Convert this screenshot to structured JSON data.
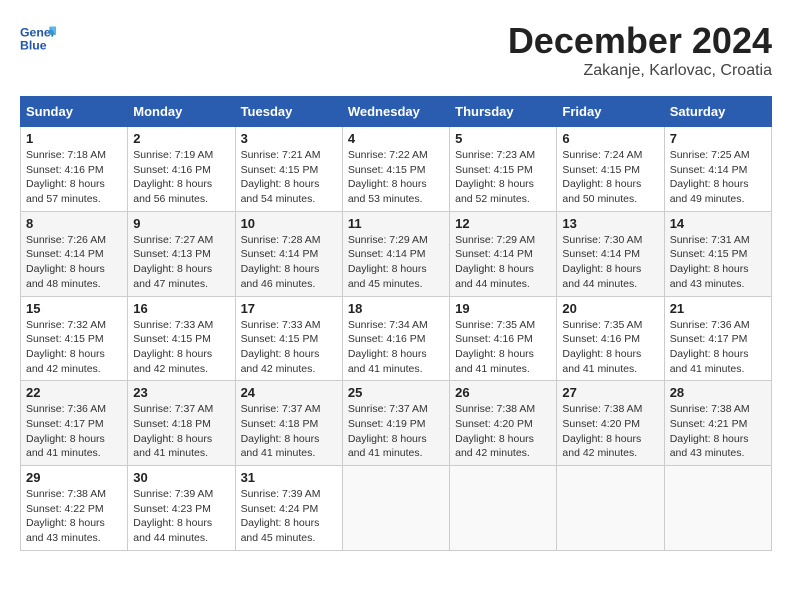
{
  "header": {
    "logo_line1": "General",
    "logo_line2": "Blue",
    "month_title": "December 2024",
    "subtitle": "Zakanje, Karlovac, Croatia"
  },
  "calendar": {
    "days_of_week": [
      "Sunday",
      "Monday",
      "Tuesday",
      "Wednesday",
      "Thursday",
      "Friday",
      "Saturday"
    ],
    "weeks": [
      [
        null,
        null,
        null,
        null,
        null,
        null,
        null
      ]
    ],
    "cells": [
      {
        "day": null,
        "lines": []
      },
      {
        "day": null,
        "lines": []
      },
      {
        "day": null,
        "lines": []
      },
      {
        "day": null,
        "lines": []
      },
      {
        "day": null,
        "lines": []
      },
      {
        "day": null,
        "lines": []
      },
      {
        "day": null,
        "lines": []
      }
    ]
  },
  "days": [
    {
      "date": "1",
      "sunrise": "Sunrise: 7:18 AM",
      "sunset": "Sunset: 4:16 PM",
      "daylight": "Daylight: 8 hours and 57 minutes."
    },
    {
      "date": "2",
      "sunrise": "Sunrise: 7:19 AM",
      "sunset": "Sunset: 4:16 PM",
      "daylight": "Daylight: 8 hours and 56 minutes."
    },
    {
      "date": "3",
      "sunrise": "Sunrise: 7:21 AM",
      "sunset": "Sunset: 4:15 PM",
      "daylight": "Daylight: 8 hours and 54 minutes."
    },
    {
      "date": "4",
      "sunrise": "Sunrise: 7:22 AM",
      "sunset": "Sunset: 4:15 PM",
      "daylight": "Daylight: 8 hours and 53 minutes."
    },
    {
      "date": "5",
      "sunrise": "Sunrise: 7:23 AM",
      "sunset": "Sunset: 4:15 PM",
      "daylight": "Daylight: 8 hours and 52 minutes."
    },
    {
      "date": "6",
      "sunrise": "Sunrise: 7:24 AM",
      "sunset": "Sunset: 4:15 PM",
      "daylight": "Daylight: 8 hours and 50 minutes."
    },
    {
      "date": "7",
      "sunrise": "Sunrise: 7:25 AM",
      "sunset": "Sunset: 4:14 PM",
      "daylight": "Daylight: 8 hours and 49 minutes."
    },
    {
      "date": "8",
      "sunrise": "Sunrise: 7:26 AM",
      "sunset": "Sunset: 4:14 PM",
      "daylight": "Daylight: 8 hours and 48 minutes."
    },
    {
      "date": "9",
      "sunrise": "Sunrise: 7:27 AM",
      "sunset": "Sunset: 4:13 PM",
      "daylight": "Daylight: 8 hours and 47 minutes."
    },
    {
      "date": "10",
      "sunrise": "Sunrise: 7:28 AM",
      "sunset": "Sunset: 4:14 PM",
      "daylight": "Daylight: 8 hours and 46 minutes."
    },
    {
      "date": "11",
      "sunrise": "Sunrise: 7:29 AM",
      "sunset": "Sunset: 4:14 PM",
      "daylight": "Daylight: 8 hours and 45 minutes."
    },
    {
      "date": "12",
      "sunrise": "Sunrise: 7:29 AM",
      "sunset": "Sunset: 4:14 PM",
      "daylight": "Daylight: 8 hours and 44 minutes."
    },
    {
      "date": "13",
      "sunrise": "Sunrise: 7:30 AM",
      "sunset": "Sunset: 4:14 PM",
      "daylight": "Daylight: 8 hours and 44 minutes."
    },
    {
      "date": "14",
      "sunrise": "Sunrise: 7:31 AM",
      "sunset": "Sunset: 4:15 PM",
      "daylight": "Daylight: 8 hours and 43 minutes."
    },
    {
      "date": "15",
      "sunrise": "Sunrise: 7:32 AM",
      "sunset": "Sunset: 4:15 PM",
      "daylight": "Daylight: 8 hours and 42 minutes."
    },
    {
      "date": "16",
      "sunrise": "Sunrise: 7:33 AM",
      "sunset": "Sunset: 4:15 PM",
      "daylight": "Daylight: 8 hours and 42 minutes."
    },
    {
      "date": "17",
      "sunrise": "Sunrise: 7:33 AM",
      "sunset": "Sunset: 4:15 PM",
      "daylight": "Daylight: 8 hours and 42 minutes."
    },
    {
      "date": "18",
      "sunrise": "Sunrise: 7:34 AM",
      "sunset": "Sunset: 4:16 PM",
      "daylight": "Daylight: 8 hours and 41 minutes."
    },
    {
      "date": "19",
      "sunrise": "Sunrise: 7:35 AM",
      "sunset": "Sunset: 4:16 PM",
      "daylight": "Daylight: 8 hours and 41 minutes."
    },
    {
      "date": "20",
      "sunrise": "Sunrise: 7:35 AM",
      "sunset": "Sunset: 4:16 PM",
      "daylight": "Daylight: 8 hours and 41 minutes."
    },
    {
      "date": "21",
      "sunrise": "Sunrise: 7:36 AM",
      "sunset": "Sunset: 4:17 PM",
      "daylight": "Daylight: 8 hours and 41 minutes."
    },
    {
      "date": "22",
      "sunrise": "Sunrise: 7:36 AM",
      "sunset": "Sunset: 4:17 PM",
      "daylight": "Daylight: 8 hours and 41 minutes."
    },
    {
      "date": "23",
      "sunrise": "Sunrise: 7:37 AM",
      "sunset": "Sunset: 4:18 PM",
      "daylight": "Daylight: 8 hours and 41 minutes."
    },
    {
      "date": "24",
      "sunrise": "Sunrise: 7:37 AM",
      "sunset": "Sunset: 4:18 PM",
      "daylight": "Daylight: 8 hours and 41 minutes."
    },
    {
      "date": "25",
      "sunrise": "Sunrise: 7:37 AM",
      "sunset": "Sunset: 4:19 PM",
      "daylight": "Daylight: 8 hours and 41 minutes."
    },
    {
      "date": "26",
      "sunrise": "Sunrise: 7:38 AM",
      "sunset": "Sunset: 4:20 PM",
      "daylight": "Daylight: 8 hours and 42 minutes."
    },
    {
      "date": "27",
      "sunrise": "Sunrise: 7:38 AM",
      "sunset": "Sunset: 4:20 PM",
      "daylight": "Daylight: 8 hours and 42 minutes."
    },
    {
      "date": "28",
      "sunrise": "Sunrise: 7:38 AM",
      "sunset": "Sunset: 4:21 PM",
      "daylight": "Daylight: 8 hours and 43 minutes."
    },
    {
      "date": "29",
      "sunrise": "Sunrise: 7:38 AM",
      "sunset": "Sunset: 4:22 PM",
      "daylight": "Daylight: 8 hours and 43 minutes."
    },
    {
      "date": "30",
      "sunrise": "Sunrise: 7:39 AM",
      "sunset": "Sunset: 4:23 PM",
      "daylight": "Daylight: 8 hours and 44 minutes."
    },
    {
      "date": "31",
      "sunrise": "Sunrise: 7:39 AM",
      "sunset": "Sunset: 4:24 PM",
      "daylight": "Daylight: 8 hours and 45 minutes."
    }
  ],
  "colors": {
    "header_bg": "#2a5db0",
    "header_text": "#ffffff",
    "title_color": "#222222",
    "subtitle_color": "#444444"
  }
}
